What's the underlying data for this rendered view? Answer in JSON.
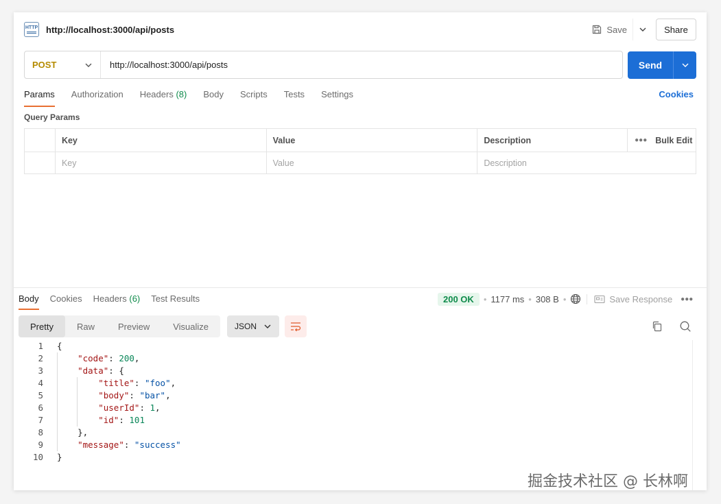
{
  "header": {
    "tab_title": "http://localhost:3000/api/posts",
    "save_label": "Save",
    "share_label": "Share"
  },
  "request": {
    "method": "POST",
    "url": "http://localhost:3000/api/posts",
    "send_label": "Send"
  },
  "request_tabs": [
    {
      "label": "Params",
      "active": true
    },
    {
      "label": "Authorization"
    },
    {
      "label": "Headers",
      "count": "(8)"
    },
    {
      "label": "Body"
    },
    {
      "label": "Scripts"
    },
    {
      "label": "Tests"
    },
    {
      "label": "Settings"
    }
  ],
  "cookies_label": "Cookies",
  "query_params": {
    "title": "Query Params",
    "columns": [
      "Key",
      "Value",
      "Description"
    ],
    "bulk_edit": "Bulk Edit",
    "placeholders": [
      "Key",
      "Value",
      "Description"
    ]
  },
  "response": {
    "tabs": [
      "Body",
      "Cookies",
      "Headers",
      "Test Results"
    ],
    "headers_count": "(6)",
    "status": "200 OK",
    "time": "1177 ms",
    "size": "308 B",
    "save_response": "Save Response",
    "views": [
      "Pretty",
      "Raw",
      "Preview",
      "Visualize"
    ],
    "format": "JSON"
  },
  "code_lines": [
    "{",
    "    \"code\": 200,",
    "    \"data\": {",
    "        \"title\": \"foo\",",
    "        \"body\": \"bar\",",
    "        \"userId\": 1,",
    "        \"id\": 101",
    "    },",
    "    \"message\": \"success\"",
    "}"
  ],
  "watermark": "掘金技术社区 @ 长林啊"
}
